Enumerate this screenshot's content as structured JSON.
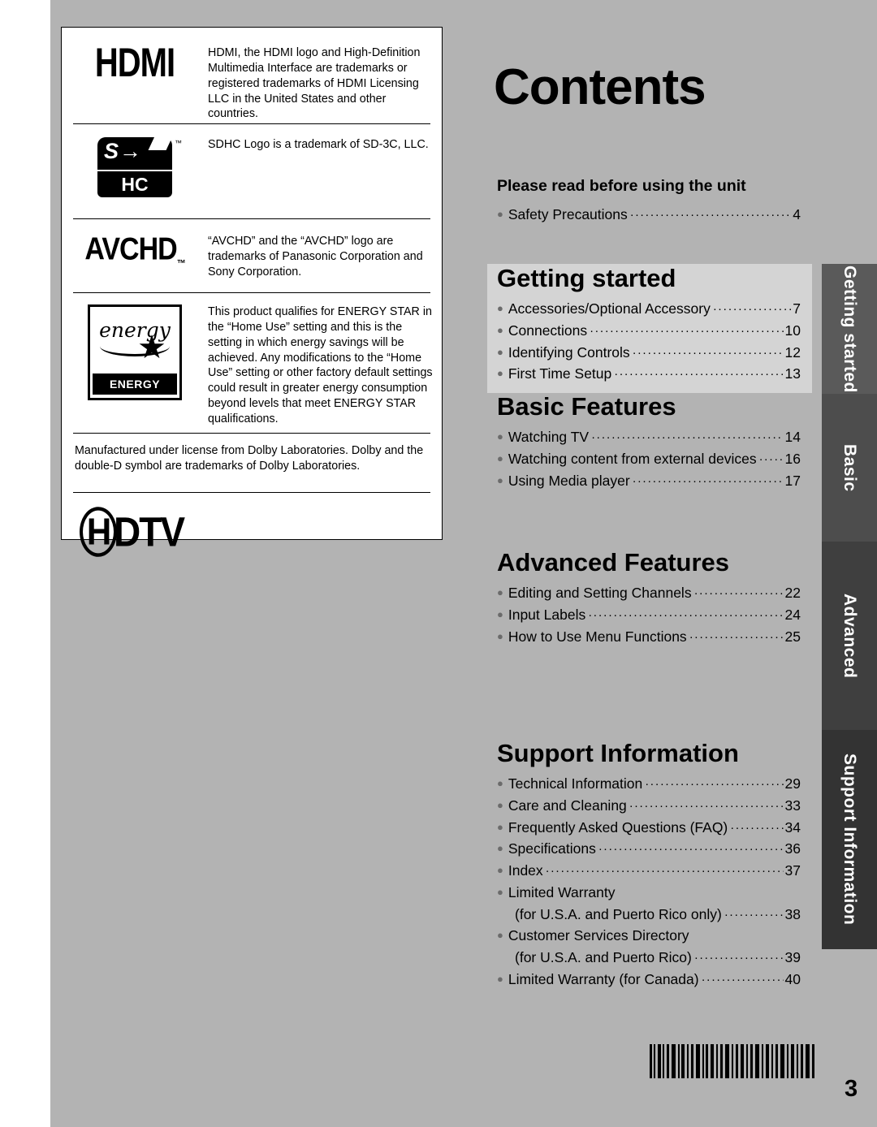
{
  "page": {
    "title": "Contents",
    "number": "3"
  },
  "trademarks": [
    {
      "logo": "hdmi-logo",
      "logo_text": "HDMI",
      "text": "HDMI, the HDMI logo and High-Definition Multimedia Interface are trademarks or registered trademarks of HDMI Licensing LLC in the United States and other countries."
    },
    {
      "logo": "sdhc-logo",
      "logo_text": "SD HC",
      "text": "SDHC Logo is a trademark of SD-3C, LLC."
    },
    {
      "logo": "avchd-logo",
      "logo_text": "AVCHD",
      "text": "“AVCHD” and the “AVCHD” logo are trademarks of Panasonic Corporation and Sony Corporation."
    },
    {
      "logo": "energy-star-logo",
      "logo_text": "energy",
      "logo_sub": "ENERGY STAR",
      "text": "This product qualifies for ENERGY STAR in the “Home Use” setting and this is the setting in which energy savings will be achieved. Any modifications to the “Home Use” setting or other factory default settings could result in greater energy consumption beyond levels that meet ENERGY STAR qualifications."
    }
  ],
  "dolby_text": "Manufactured under license from Dolby Laboratories. Dolby and the double-D symbol are trademarks of Dolby Laboratories.",
  "hdtv_logo_text": "DTV",
  "hdtv_logo_h": "H",
  "sections": {
    "please_read": {
      "heading": "Please read before using the unit",
      "items": [
        {
          "label": "Safety Precautions",
          "page": "4"
        }
      ]
    },
    "getting_started": {
      "heading": "Getting started",
      "items": [
        {
          "label": "Accessories/Optional Accessory",
          "page": "7"
        },
        {
          "label": "Connections",
          "page": "10"
        },
        {
          "label": "Identifying Controls",
          "page": "12"
        },
        {
          "label": "First Time Setup",
          "page": "13"
        }
      ]
    },
    "basic_features": {
      "heading": "Basic Features",
      "items": [
        {
          "label": "Watching TV",
          "page": "14"
        },
        {
          "label": "Watching content from external devices",
          "page": "16"
        },
        {
          "label": "Using Media player",
          "page": "17"
        }
      ]
    },
    "advanced_features": {
      "heading": "Advanced Features",
      "items": [
        {
          "label": "Editing and Setting Channels",
          "page": "22"
        },
        {
          "label": "Input Labels",
          "page": "24"
        },
        {
          "label": "How to Use Menu Functions",
          "page": "25"
        }
      ]
    },
    "support_information": {
      "heading": "Support Information",
      "items": [
        {
          "label": "Technical Information",
          "page": "29"
        },
        {
          "label": "Care and Cleaning",
          "page": "33"
        },
        {
          "label": "Frequently Asked Questions (FAQ)",
          "page": "34"
        },
        {
          "label": "Specifications",
          "page": "36"
        },
        {
          "label": "Index",
          "page": "37"
        },
        {
          "label": "Limited Warranty",
          "page": ""
        },
        {
          "label": "(for U.S.A. and Puerto Rico only)",
          "page": "38",
          "sub": true
        },
        {
          "label": "Customer Services Directory",
          "page": ""
        },
        {
          "label": "(for U.S.A. and Puerto Rico)",
          "page": "39",
          "sub": true
        },
        {
          "label": "Limited Warranty (for Canada)",
          "page": "40"
        }
      ]
    }
  },
  "tabs": [
    {
      "label": "Getting started",
      "color": "#5a5a5a"
    },
    {
      "label": "Basic",
      "color": "#4d4d4d"
    },
    {
      "label": "Advanced",
      "color": "#3f3f3f"
    },
    {
      "label": "Support Information",
      "color": "#333333"
    }
  ]
}
